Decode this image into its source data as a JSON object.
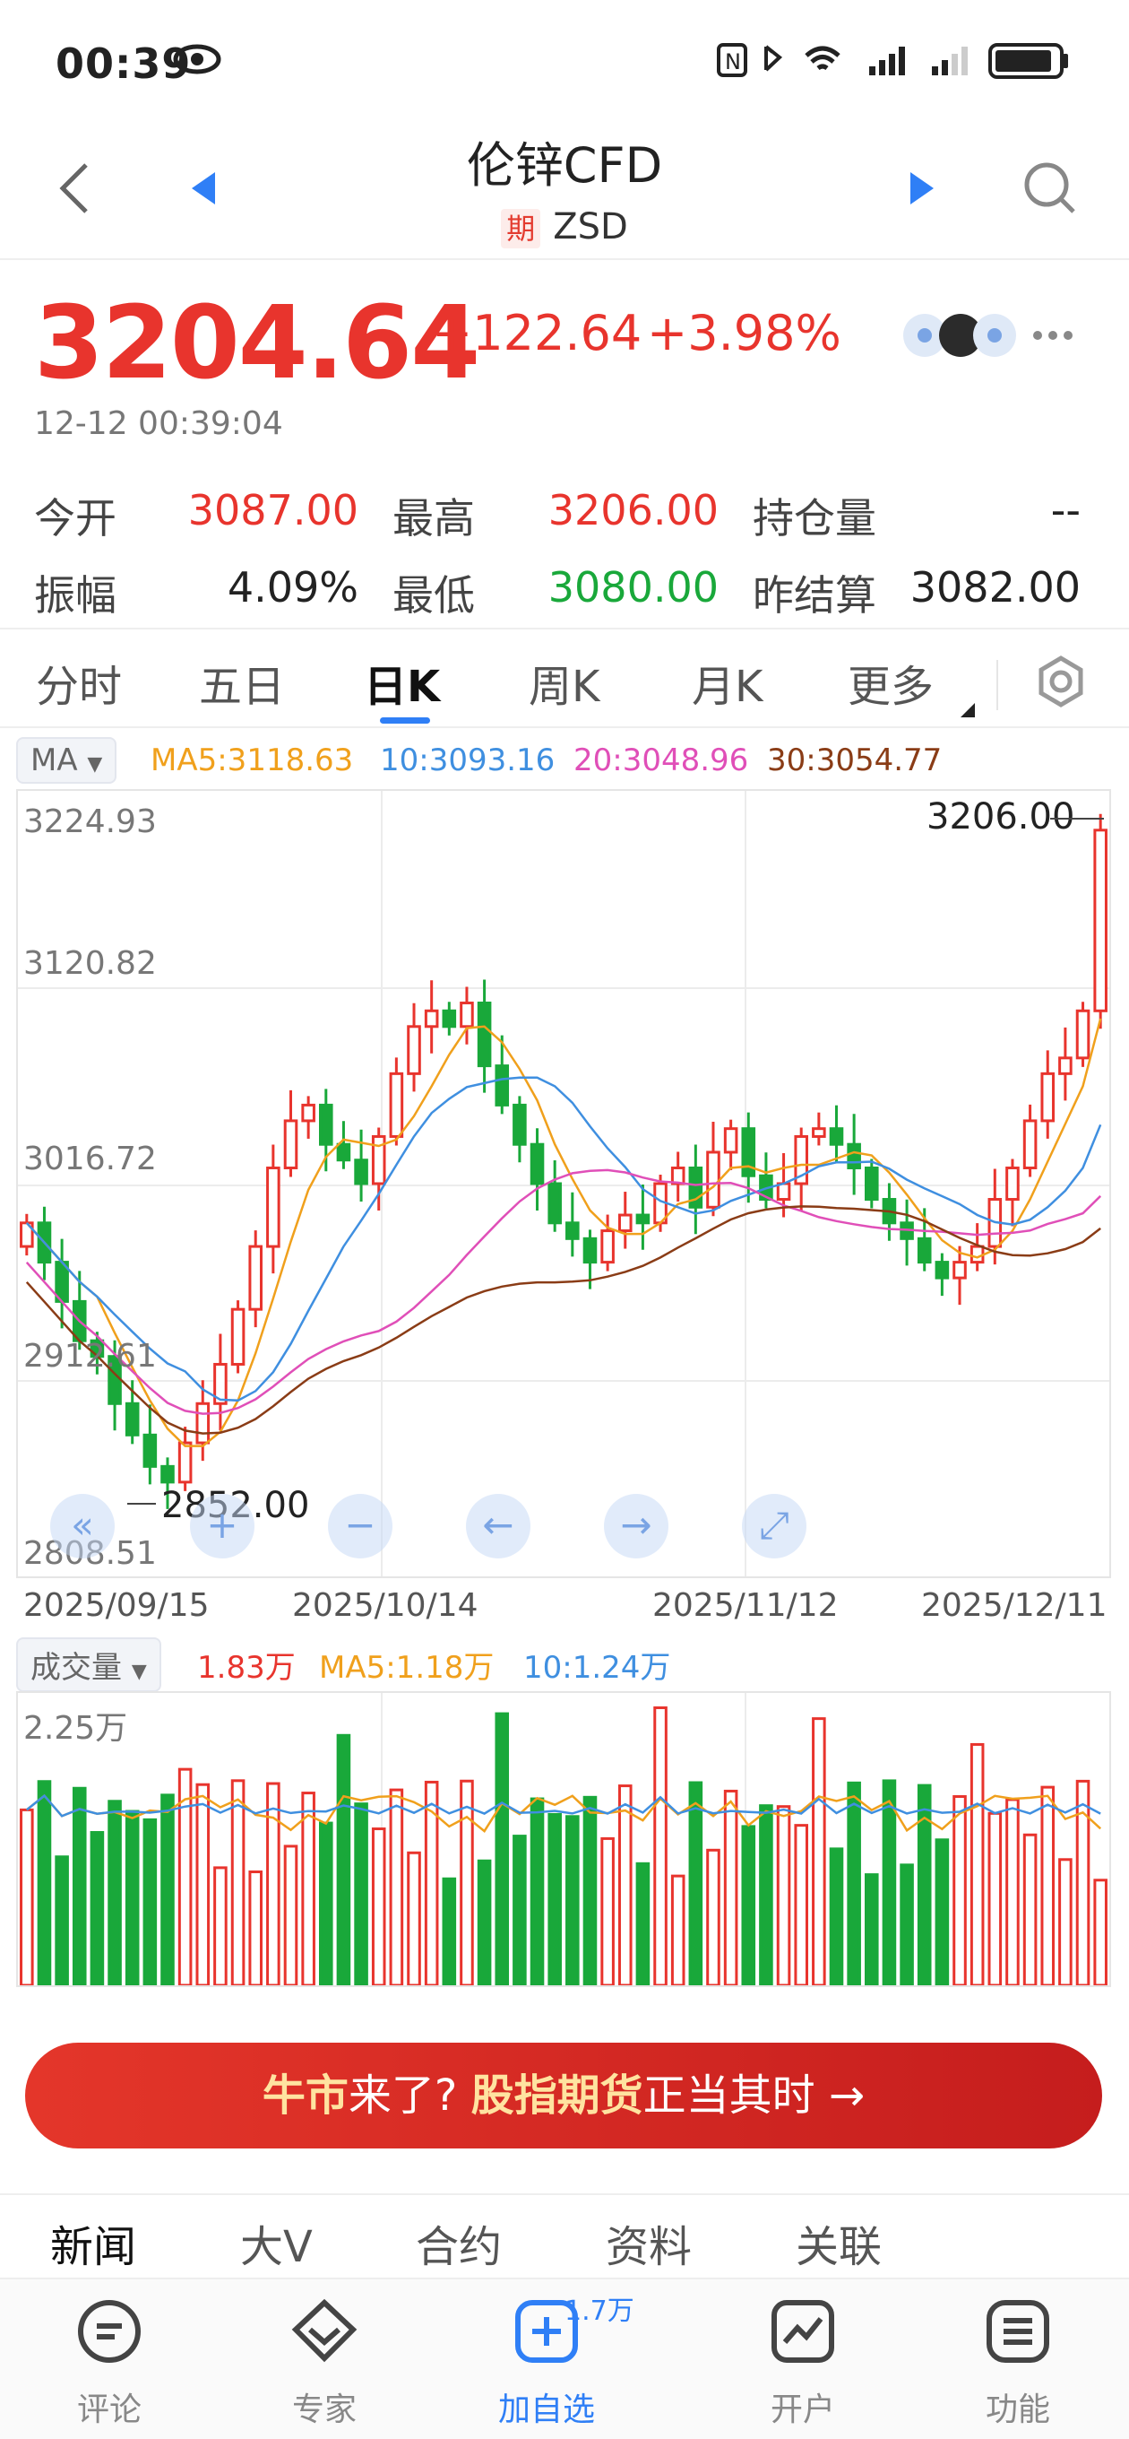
{
  "status_bar": {
    "time": "00:39"
  },
  "header": {
    "title": "伦锌CFD",
    "badge": "期",
    "code": "ZSD"
  },
  "quote": {
    "price": "3204.64",
    "change": "+122.64",
    "change_pct": "+3.98%",
    "timestamp": "12-12 00:39:04"
  },
  "stats": {
    "open_label": "今开",
    "open": "3087.00",
    "high_label": "最高",
    "high": "3206.00",
    "oi_label": "持仓量",
    "oi": "--",
    "amp_label": "振幅",
    "amp": "4.09%",
    "low_label": "最低",
    "low": "3080.00",
    "prev_label": "昨结算",
    "prev": "3082.00"
  },
  "tabs": [
    "分时",
    "五日",
    "日K",
    "周K",
    "月K",
    "更多"
  ],
  "indicator": {
    "selector": "MA",
    "ma5": "MA5:3118.63",
    "ma10": "10:3093.16",
    "ma20": "20:3048.96",
    "ma30": "30:3054.77"
  },
  "volume_indicator": {
    "selector": "成交量",
    "vol": "1.83万",
    "ma5": "MA5:1.18万",
    "ma10": "10:1.24万"
  },
  "colors": {
    "up": "#e8342d",
    "down": "#19a83a",
    "ma5": "#f0a01c",
    "ma10": "#3f8fe0",
    "ma20": "#e04fb8",
    "ma30": "#8a3c16"
  },
  "chart_data": {
    "type": "candlestick",
    "y_ticks": [
      "3224.93",
      "3120.82",
      "3016.72",
      "2912.61",
      "2808.51"
    ],
    "ylim": [
      2808.51,
      3224.93
    ],
    "x_ticks": [
      "2025/09/15",
      "2025/10/14",
      "2025/11/12",
      "2025/12/11"
    ],
    "high_marker": "3206.00",
    "low_marker": "2852.00",
    "volume_max_label": "2.25万",
    "volume_ylim": [
      0,
      2.25
    ]
  },
  "banner": {
    "part1": "牛市",
    "part2": "来了? ",
    "part3": "股指期货",
    "part4": "正当其时 ",
    "arrow": "→"
  },
  "news_tabs": [
    "新闻",
    "大V",
    "合约",
    "资料",
    "关联"
  ],
  "bottom_nav": [
    {
      "label": "评论"
    },
    {
      "label": "专家"
    },
    {
      "label": "加自选",
      "badge": "1.7万"
    },
    {
      "label": "开户"
    },
    {
      "label": "功能"
    }
  ]
}
